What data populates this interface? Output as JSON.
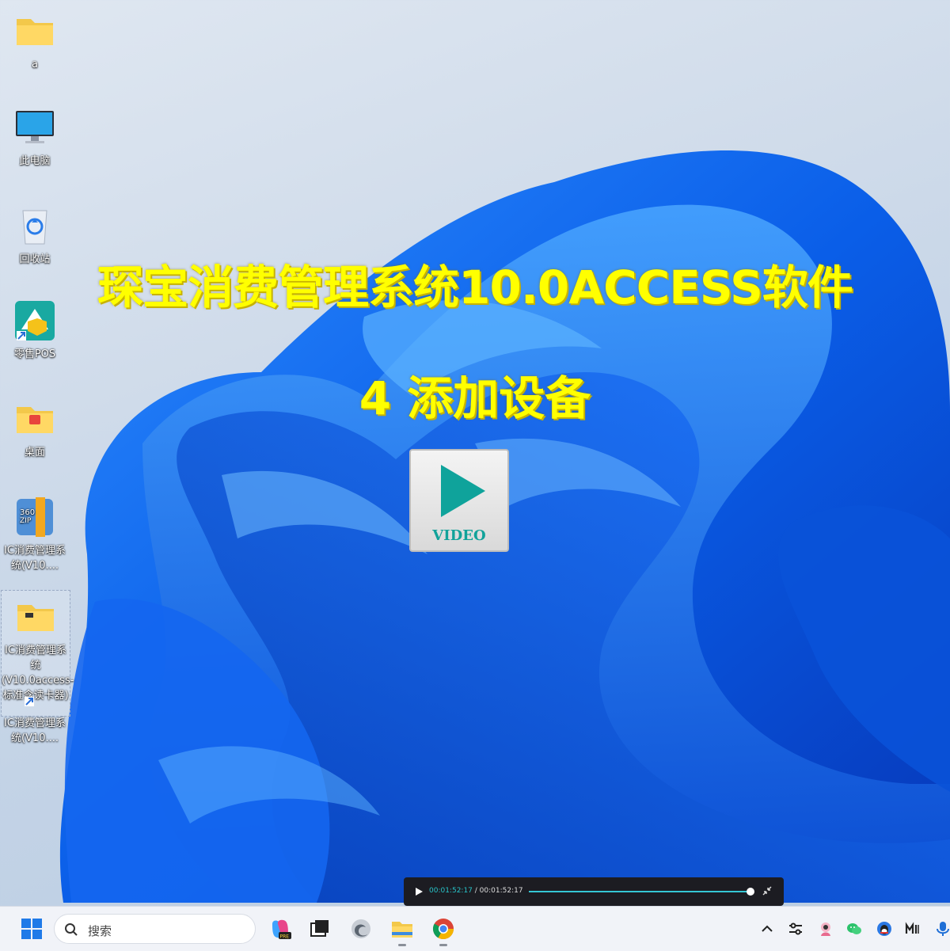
{
  "desktop": {
    "icons": [
      {
        "label": "a",
        "icon": "folder-icon"
      },
      {
        "label": "此电脑",
        "icon": "monitor-icon"
      },
      {
        "label": "回收站",
        "icon": "recycle-bin-icon"
      },
      {
        "label": "零售POS",
        "icon": "pos-app-icon"
      },
      {
        "label": "桌面",
        "icon": "folder-icon"
      },
      {
        "label": "IC消费管理系统(V10....",
        "icon": "zip-archive-icon"
      },
      {
        "label": "IC消费管理系统(V10.0access-标准含读卡器)",
        "icon": "folder-icon"
      },
      {
        "label": "IC消费管理系统(V10....",
        "icon": "chrome-shortcut-icon"
      }
    ]
  },
  "overlay": {
    "title": "琛宝消费管理系统10.0ACCESS软件",
    "subtitle": "4 添加设备",
    "video_label": "VIDEO",
    "accent_color": "#ffff00"
  },
  "media": {
    "current_time": "00:01:52:17",
    "separator": " / ",
    "total_time": "00:01:52:17",
    "progress": 1.0
  },
  "taskbar": {
    "search_placeholder": "搜索",
    "apps": [
      "start-icon",
      "copilot-icon",
      "task-view-icon",
      "edge-icon",
      "file-explorer-icon",
      "chrome-icon"
    ],
    "tray": [
      "chevron-up-icon",
      "settings-toggle-icon",
      "avatar-icon",
      "wechat-icon",
      "qq-icon",
      "input-method-icon",
      "microphone-icon"
    ]
  }
}
